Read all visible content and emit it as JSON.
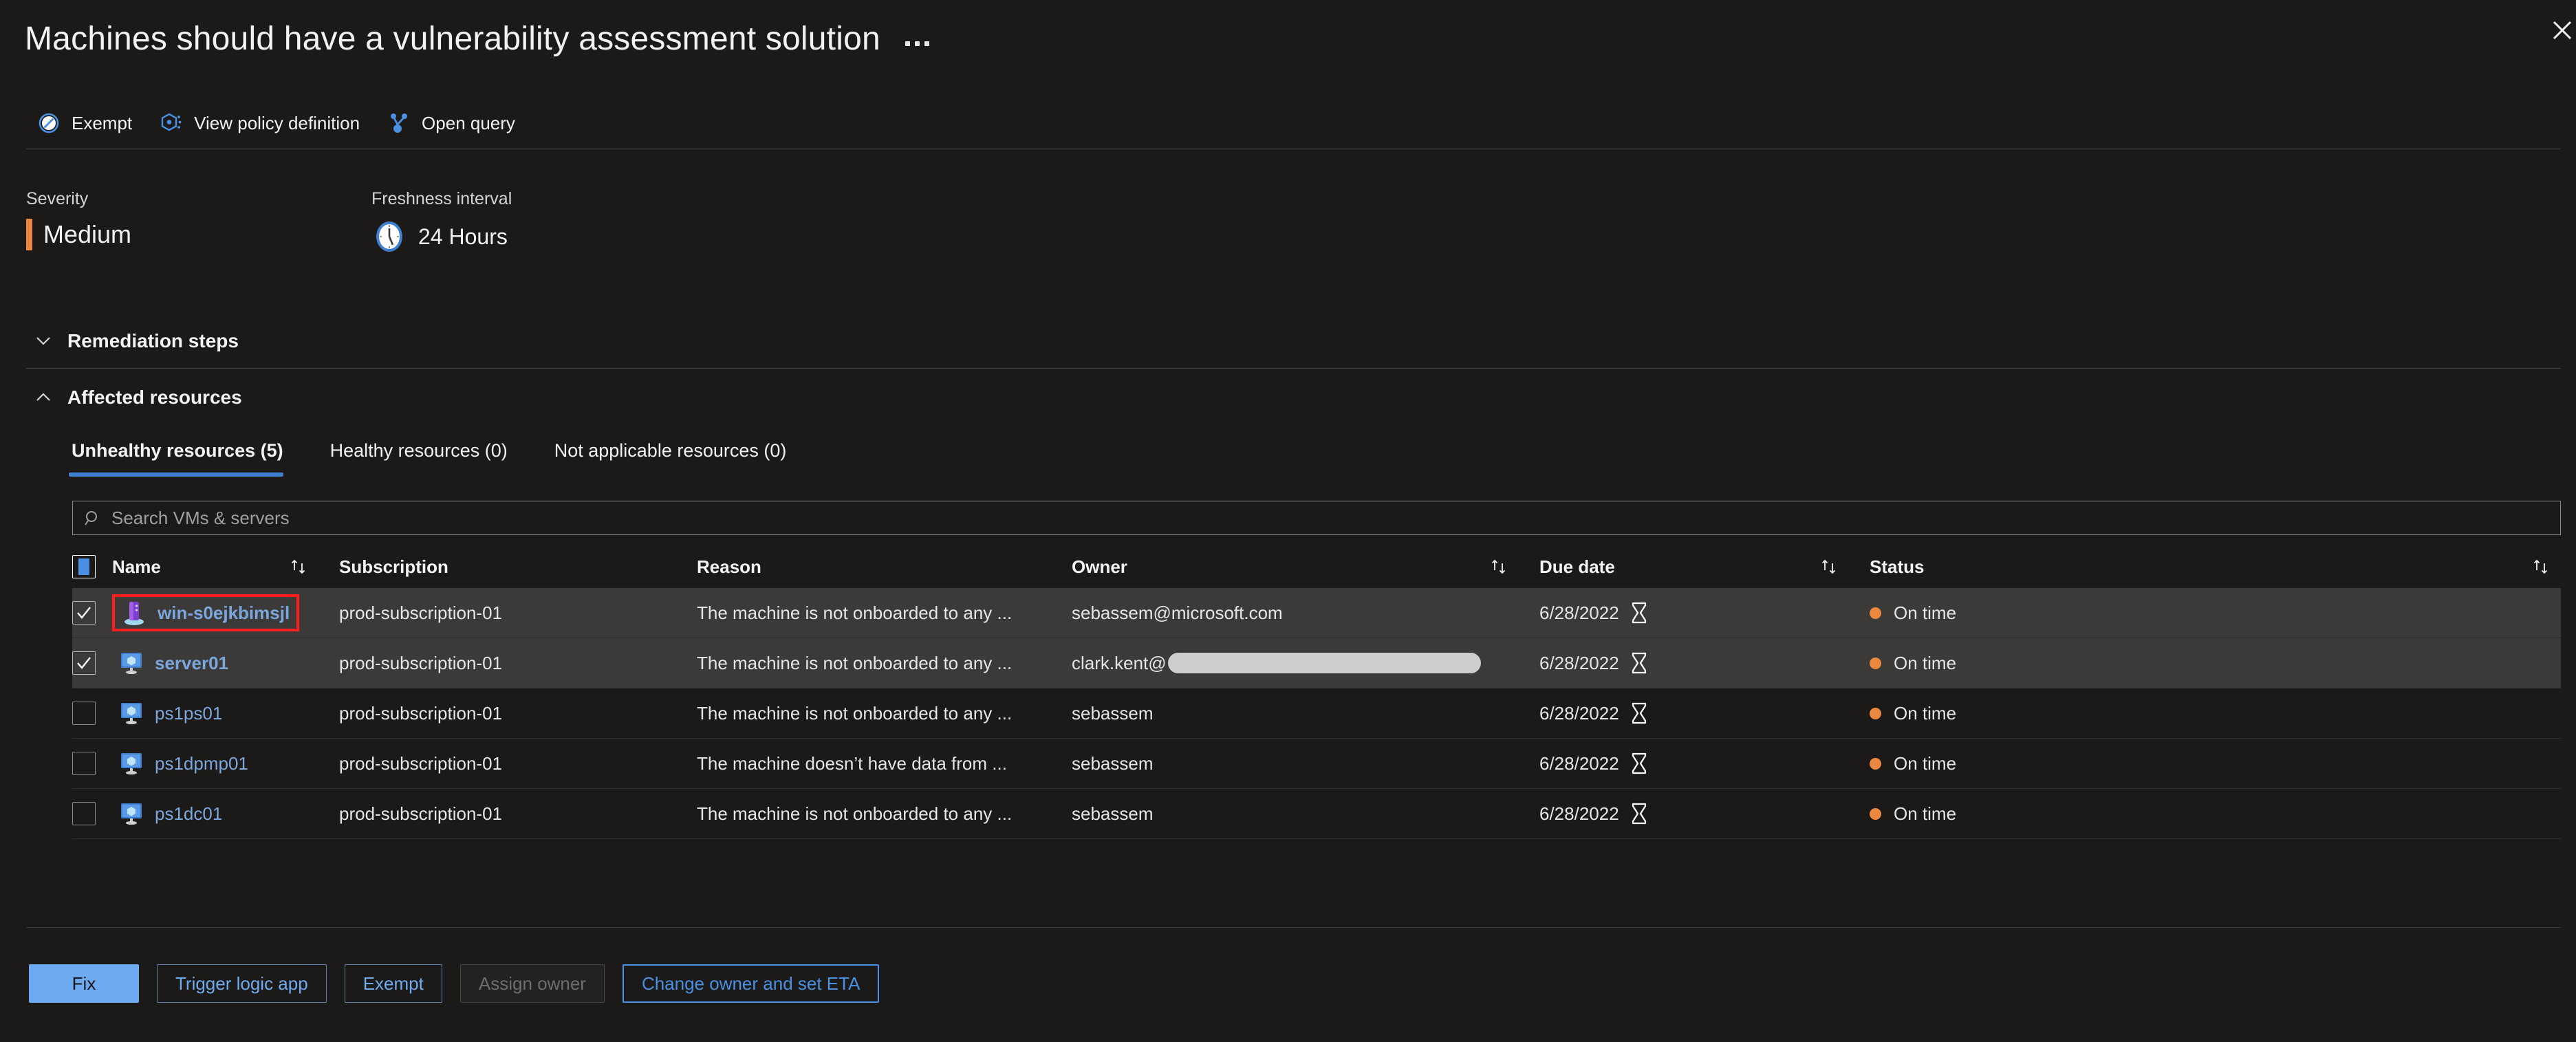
{
  "header": {
    "title": "Machines should have a vulnerability assessment solution",
    "more_label": "More options",
    "close_label": "Close"
  },
  "commandbar": [
    {
      "label": "Exempt",
      "icon": "exempt-icon"
    },
    {
      "label": "View policy definition",
      "icon": "policy-icon"
    },
    {
      "label": "Open query",
      "icon": "query-icon"
    }
  ],
  "properties": {
    "severity_label": "Severity",
    "severity_value": "Medium",
    "severity_color": "#e9883e",
    "freshness_label": "Freshness interval",
    "freshness_value": "24 Hours",
    "freshness_icon": "clock-icon"
  },
  "sections": {
    "remediation": {
      "label": "Remediation steps",
      "state": "collapsed",
      "icon": "chevron-down-icon"
    },
    "affected": {
      "label": "Affected resources",
      "state": "expanded",
      "icon": "chevron-up-icon"
    }
  },
  "tabs": [
    {
      "label": "Unhealthy resources (5)",
      "active": true
    },
    {
      "label": "Healthy resources (0)",
      "active": false
    },
    {
      "label": "Not applicable resources (0)",
      "active": false
    }
  ],
  "search": {
    "placeholder": "Search VMs & servers",
    "value": "",
    "icon": "search-icon"
  },
  "table": {
    "columns": [
      {
        "key": "name",
        "label": "Name",
        "sortable": true
      },
      {
        "key": "subscription",
        "label": "Subscription",
        "sortable": false
      },
      {
        "key": "reason",
        "label": "Reason",
        "sortable": false
      },
      {
        "key": "owner",
        "label": "Owner",
        "sortable": true
      },
      {
        "key": "due_date",
        "label": "Due date",
        "sortable": true
      },
      {
        "key": "status",
        "label": "Status",
        "sortable": true
      }
    ],
    "select_all_state": "indeterminate",
    "rows": [
      {
        "selected": true,
        "highlighted": true,
        "icon": "server-purple-icon",
        "name": "win-s0ejkbimsjl",
        "subscription": "prod-subscription-01",
        "reason": "The machine is not onboarded to any ...",
        "owner": "sebassem@microsoft.com",
        "owner_redacted": false,
        "due_date": "6/28/2022",
        "due_icon": "hourglass-icon",
        "status": "On time",
        "status_color": "#e9883e"
      },
      {
        "selected": true,
        "highlighted": false,
        "icon": "vm-blue-icon",
        "name": "server01",
        "subscription": "prod-subscription-01",
        "reason": "The machine is not onboarded to any ...",
        "owner": "clark.kent@",
        "owner_redacted": true,
        "due_date": "6/28/2022",
        "due_icon": "hourglass-icon",
        "status": "On time",
        "status_color": "#e9883e"
      },
      {
        "selected": false,
        "highlighted": false,
        "icon": "vm-blue-icon",
        "name": "ps1ps01",
        "subscription": "prod-subscription-01",
        "reason": "The machine is not onboarded to any ...",
        "owner": "sebassem",
        "owner_redacted": false,
        "due_date": "6/28/2022",
        "due_icon": "hourglass-icon",
        "status": "On time",
        "status_color": "#e9883e"
      },
      {
        "selected": false,
        "highlighted": false,
        "icon": "vm-blue-icon",
        "name": "ps1dpmp01",
        "subscription": "prod-subscription-01",
        "reason": "The machine doesn’t have data from ...",
        "owner": "sebassem",
        "owner_redacted": false,
        "due_date": "6/28/2022",
        "due_icon": "hourglass-icon",
        "status": "On time",
        "status_color": "#e9883e"
      },
      {
        "selected": false,
        "highlighted": false,
        "icon": "vm-blue-icon",
        "name": "ps1dc01",
        "subscription": "prod-subscription-01",
        "reason": "The machine is not onboarded to any ...",
        "owner": "sebassem",
        "owner_redacted": false,
        "due_date": "6/28/2022",
        "due_icon": "hourglass-icon",
        "status": "On time",
        "status_color": "#e9883e"
      }
    ]
  },
  "footer_buttons": [
    {
      "label": "Fix",
      "style": "primary",
      "disabled": false
    },
    {
      "label": "Trigger logic app",
      "style": "outline",
      "disabled": false
    },
    {
      "label": "Exempt",
      "style": "outline",
      "disabled": false
    },
    {
      "label": "Assign owner",
      "style": "disabled",
      "disabled": true
    },
    {
      "label": "Change owner and set ETA",
      "style": "focus",
      "disabled": false
    }
  ]
}
